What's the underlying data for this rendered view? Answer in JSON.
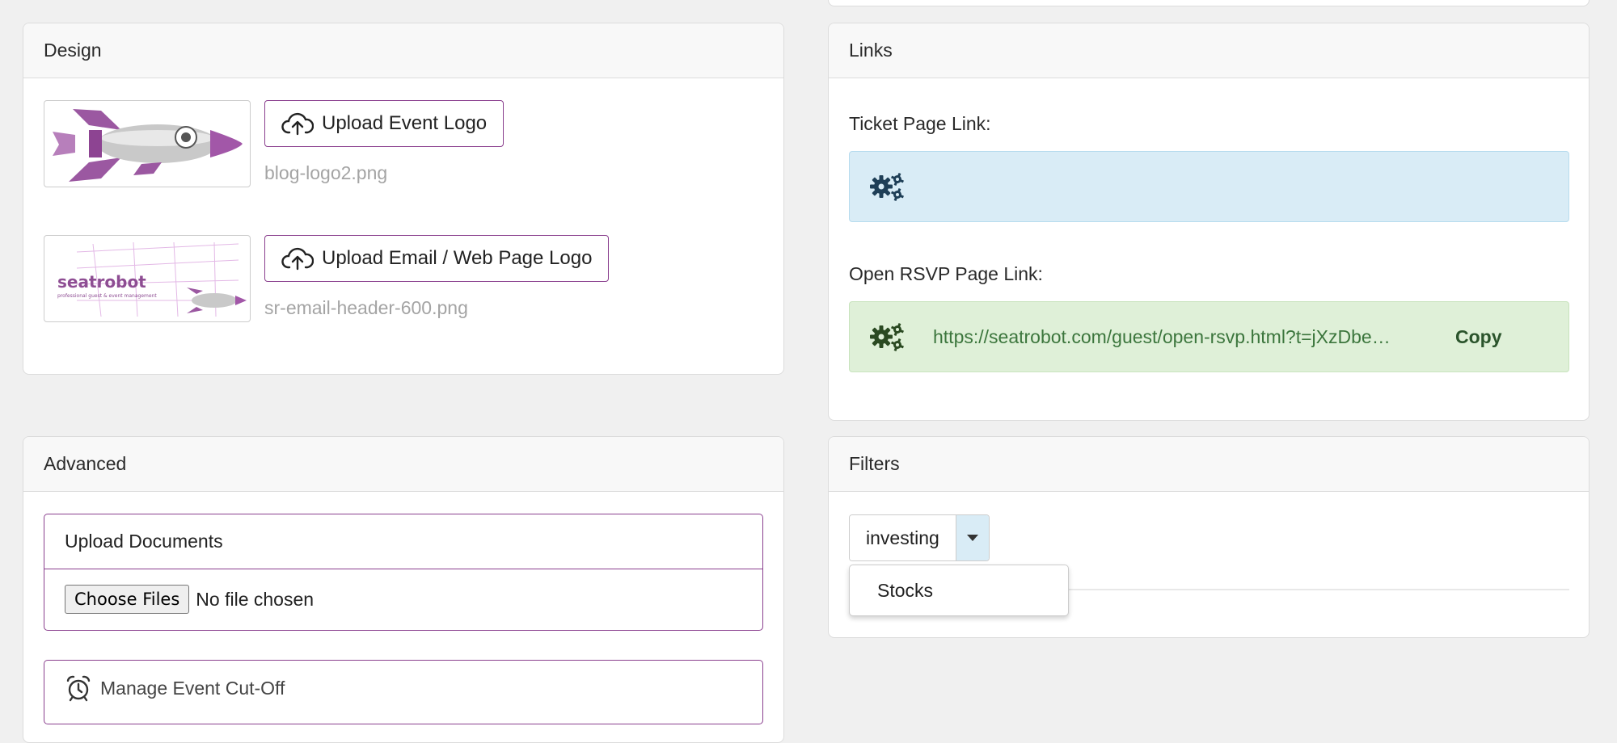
{
  "design": {
    "title": "Design",
    "event_logo": {
      "button_label": "Upload Event Logo",
      "filename": "blog-logo2.png"
    },
    "email_logo": {
      "button_label": "Upload Email / Web Page Logo",
      "filename": "sr-email-header-600.png",
      "brand": "seatrobot",
      "tagline": "professional guest & event management"
    }
  },
  "links": {
    "title": "Links",
    "ticket_label": "Ticket Page Link:",
    "rsvp_label": "Open RSVP Page Link:",
    "rsvp_url": "https://seatrobot.com/guest/open-rsvp.html?t=jXzDbe…",
    "copy_label": "Copy"
  },
  "advanced": {
    "title": "Advanced",
    "upload_documents": {
      "title": "Upload Documents",
      "choose_label": "Choose Files",
      "status": "No file chosen"
    },
    "cutoff_label": "Manage Event Cut-Off"
  },
  "filters": {
    "title": "Filters",
    "selected": "investing",
    "options": [
      "Stocks"
    ]
  },
  "colors": {
    "accent_purple": "#8a3f8e",
    "info_blue": "#d9ecf6",
    "success_green": "#dff0d8",
    "success_text": "#3c763d"
  },
  "icons": [
    "cloud-upload-icon",
    "gears-icon",
    "alarm-clock-icon",
    "caret-down-icon"
  ]
}
